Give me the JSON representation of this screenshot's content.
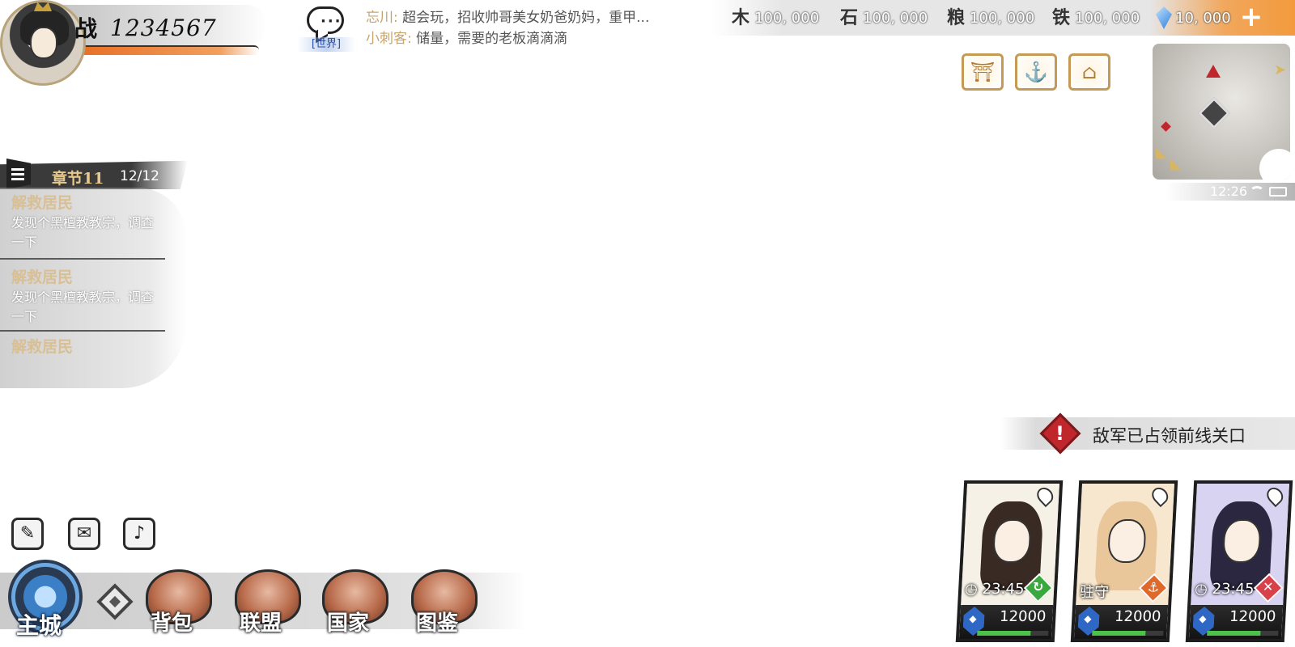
{
  "player": {
    "power_glyph": "战",
    "power_value": "1234567"
  },
  "chat": {
    "channel_tag": "[世界]",
    "messages": [
      {
        "name": "忘川:",
        "text": "超会玩，招收帅哥美女奶爸奶妈，重甲..."
      },
      {
        "name": "小刺客:",
        "text": "储量，需要的老板滴滴滴"
      }
    ]
  },
  "resources": [
    {
      "icon": "wood-icon",
      "glyph": "木",
      "value": "100, 000"
    },
    {
      "icon": "stone-icon",
      "glyph": "石",
      "value": "100, 000"
    },
    {
      "icon": "grain-icon",
      "glyph": "粮",
      "value": "100, 000"
    },
    {
      "icon": "iron-icon",
      "glyph": "铁",
      "value": "100, 000"
    },
    {
      "icon": "gem-icon",
      "glyph": "",
      "value": "10, 000"
    }
  ],
  "plus_label": "+",
  "status_bar": {
    "time": "12:26"
  },
  "quest": {
    "chapter_title": "章节11",
    "chapter_progress": "12/12",
    "items": [
      {
        "title": "解救居民",
        "desc": "发现个黑檀教教宗，调查一下"
      },
      {
        "title": "解救居民",
        "desc": "发现个黑檀教教宗，调查一下"
      },
      {
        "title": "解救居民",
        "desc": ""
      }
    ]
  },
  "alert": {
    "mark": "!",
    "text": "敌军已占领前线关口"
  },
  "quick_icons": [
    {
      "name": "scroll-icon",
      "glyph": "✎"
    },
    {
      "name": "mail-icon",
      "glyph": "✉"
    },
    {
      "name": "war-horn-icon",
      "glyph": "♪"
    }
  ],
  "nav": {
    "main_city": "主城",
    "buttons": [
      "背包",
      "联盟",
      "国家",
      "图鉴"
    ]
  },
  "heroes": [
    {
      "status": "23:45",
      "status_icon": "clock-icon",
      "badge": "↻",
      "badge_color": "#3aa83f",
      "power": "12000",
      "bar_fill": 0.75,
      "hair_color": "#3a2a24",
      "bg": "#f6f1e6"
    },
    {
      "status": "驻守",
      "status_icon": "",
      "badge": "⚓",
      "badge_color": "#e0692a",
      "power": "12000",
      "bar_fill": 0.75,
      "hair_color": "#e9c79a",
      "bg": "#f7e7cf"
    },
    {
      "status": "23:45",
      "status_icon": "clock-icon",
      "badge": "✕",
      "badge_color": "#d9414a",
      "power": "12000",
      "bar_fill": 0.75,
      "hair_color": "#2b2740",
      "bg": "#d9d3f2"
    }
  ]
}
